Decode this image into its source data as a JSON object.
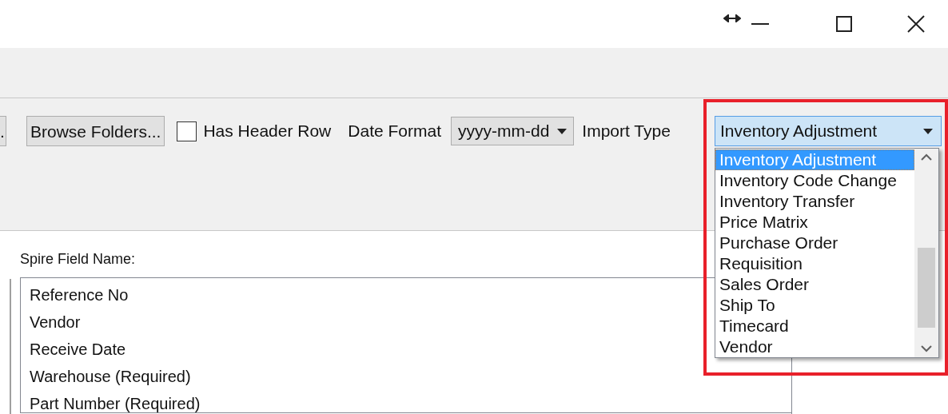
{
  "toolbar": {
    "cut_button": ".",
    "browse_button": "Browse Folders...",
    "has_header_row": {
      "label": "Has Header Row",
      "checked": false
    },
    "date_format": {
      "label": "Date Format",
      "value": "yyyy-mm-dd"
    },
    "import_type": {
      "label": "Import Type",
      "value": "Inventory Adjustment",
      "expanded": true,
      "options": [
        {
          "label": "Inventory Adjustment",
          "selected": true
        },
        {
          "label": "Inventory Code Change",
          "selected": false
        },
        {
          "label": "Inventory Transfer",
          "selected": false
        },
        {
          "label": "Price Matrix",
          "selected": false
        },
        {
          "label": "Purchase Order",
          "selected": false
        },
        {
          "label": "Requisition",
          "selected": false
        },
        {
          "label": "Sales Order",
          "selected": false
        },
        {
          "label": "Ship To",
          "selected": false
        },
        {
          "label": "Timecard",
          "selected": false
        },
        {
          "label": "Vendor",
          "selected": false
        }
      ]
    }
  },
  "field_list": {
    "label": "Spire Field Name:",
    "items": [
      "Reference No",
      "Vendor",
      "Receive Date",
      "Warehouse (Required)",
      "Part Number (Required)"
    ]
  }
}
